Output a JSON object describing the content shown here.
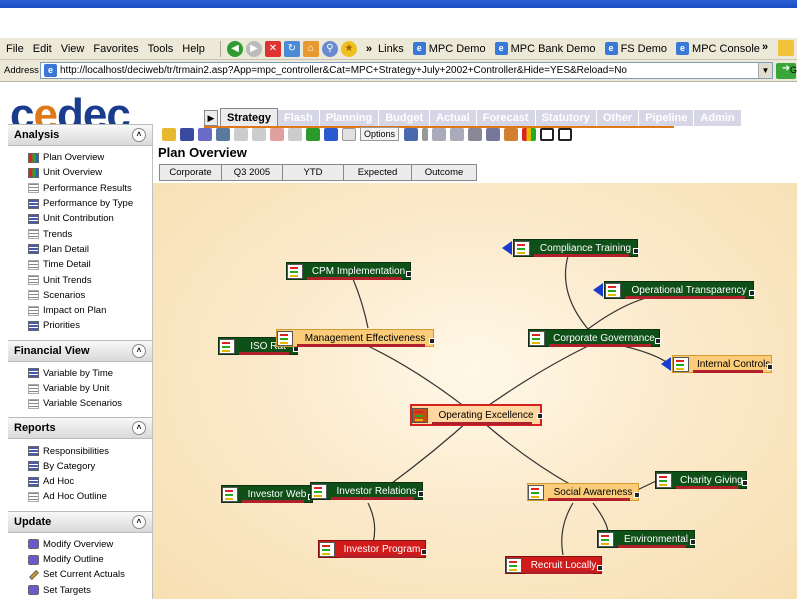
{
  "browser": {
    "menu": [
      "File",
      "Edit",
      "View",
      "Favorites",
      "Tools",
      "Help"
    ],
    "links_label": "Links",
    "links": [
      "MPC Demo",
      "MPC Bank Demo",
      "FS Demo",
      "MPC Console"
    ],
    "address_label": "Address",
    "address_url": "http://localhost/deciweb/tr/trmain2.asp?App=mpc_controller&Cat=MPC+Strategy+July+2002+Controller&Hide=YES&Reload=No",
    "go_label": "Go"
  },
  "app": {
    "logo": "cedec",
    "tabs": [
      "Strategy",
      "Flash",
      "Planning",
      "Budget",
      "Actual",
      "Forecast",
      "Statutory",
      "Other",
      "Pipeline",
      "Admin"
    ],
    "options_label": "Options"
  },
  "sidebar": {
    "sections": [
      {
        "title": "Analysis",
        "items": [
          {
            "label": "Plan Overview",
            "icon": "chart-icon"
          },
          {
            "label": "Unit Overview",
            "icon": "chart-icon"
          },
          {
            "label": "Performance Results",
            "icon": "document-icon"
          },
          {
            "label": "Performance by Type",
            "icon": "table-icon"
          },
          {
            "label": "Unit Contribution",
            "icon": "table-icon"
          },
          {
            "label": "Trends",
            "icon": "document-icon"
          },
          {
            "label": "Plan Detail",
            "icon": "table-icon"
          },
          {
            "label": "Time Detail",
            "icon": "document-icon"
          },
          {
            "label": "Unit Trends",
            "icon": "document-icon"
          },
          {
            "label": "Scenarios",
            "icon": "document-icon"
          },
          {
            "label": "Impact on Plan",
            "icon": "document-icon"
          },
          {
            "label": "Priorities",
            "icon": "table-icon"
          }
        ]
      },
      {
        "title": "Financial View",
        "items": [
          {
            "label": "Variable by Time",
            "icon": "table-icon"
          },
          {
            "label": "Variable by Unit",
            "icon": "document-icon"
          },
          {
            "label": "Variable Scenarios",
            "icon": "document-icon"
          }
        ]
      },
      {
        "title": "Reports",
        "items": [
          {
            "label": "Responsibilities",
            "icon": "table-icon"
          },
          {
            "label": "By Category",
            "icon": "table-icon"
          },
          {
            "label": "Ad Hoc",
            "icon": "table-icon"
          },
          {
            "label": "Ad Hoc Outline",
            "icon": "document-icon"
          }
        ]
      },
      {
        "title": "Update",
        "items": [
          {
            "label": "Modify Overview",
            "icon": "edit-icon"
          },
          {
            "label": "Modify Outline",
            "icon": "edit-icon"
          },
          {
            "label": "Set Current Actuals",
            "icon": "pen-icon"
          },
          {
            "label": "Set Targets",
            "icon": "edit-icon"
          }
        ]
      }
    ]
  },
  "main": {
    "page_title": "Plan Overview",
    "columns": [
      "Corporate",
      "Q3 2005",
      "YTD",
      "Expected",
      "Outcome"
    ],
    "nodes": {
      "center": "Operating Excellence",
      "compliance": "Compliance Training",
      "cpm": "CPM Implementation",
      "transparency": "Operational Transparency",
      "iso": "ISO Rat",
      "mgmt": "Management Effectiveness",
      "governance": "Corporate Governance",
      "internal": "Internal Controls",
      "investor_web": "Investor Web",
      "investor_rel": "Investor Relations",
      "social": "Social Awareness",
      "charity": "Charity Giving",
      "environmental": "Environmental",
      "investor_prog": "Investor Program",
      "recruit": "Recruit Locally"
    }
  },
  "colors": {
    "brand": "#1a3c8c",
    "accent": "#e07818",
    "node_green": "#0f4f18",
    "node_red": "#d11a1a",
    "node_orange": "#fbcd7a"
  }
}
